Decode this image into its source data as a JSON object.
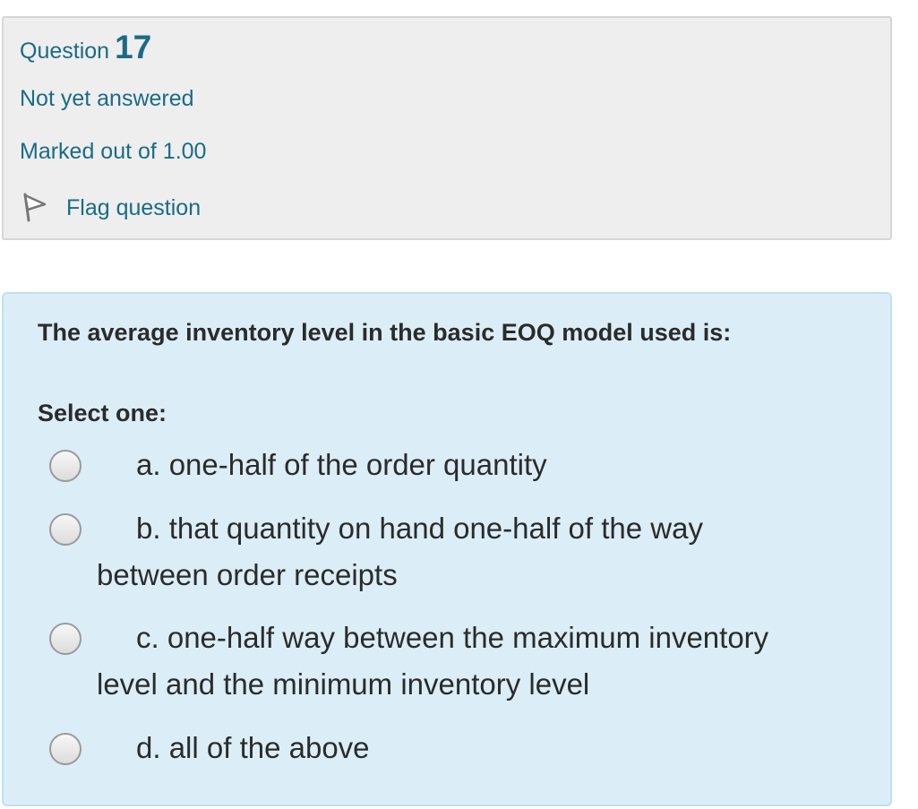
{
  "info": {
    "question_label": "Question",
    "question_number": "17",
    "state": "Not yet answered",
    "grade": "Marked out of 1.00",
    "flag_label": "Flag question",
    "flag_icon": "flag-icon"
  },
  "question": {
    "text": "The average inventory level in the basic EOQ model used is:",
    "prompt": "Select one:",
    "options": [
      {
        "label": "a. one-half of the order quantity"
      },
      {
        "label": "b. that quantity on hand one-half of the way between order receipts"
      },
      {
        "label": "c. one-half way between the maximum inventory level and the minimum inventory level"
      },
      {
        "label": "d. all of the above"
      }
    ]
  },
  "colors": {
    "accent": "#1a6b86",
    "info_bg": "#eeeeee",
    "formulation_bg": "#dbeef7"
  }
}
